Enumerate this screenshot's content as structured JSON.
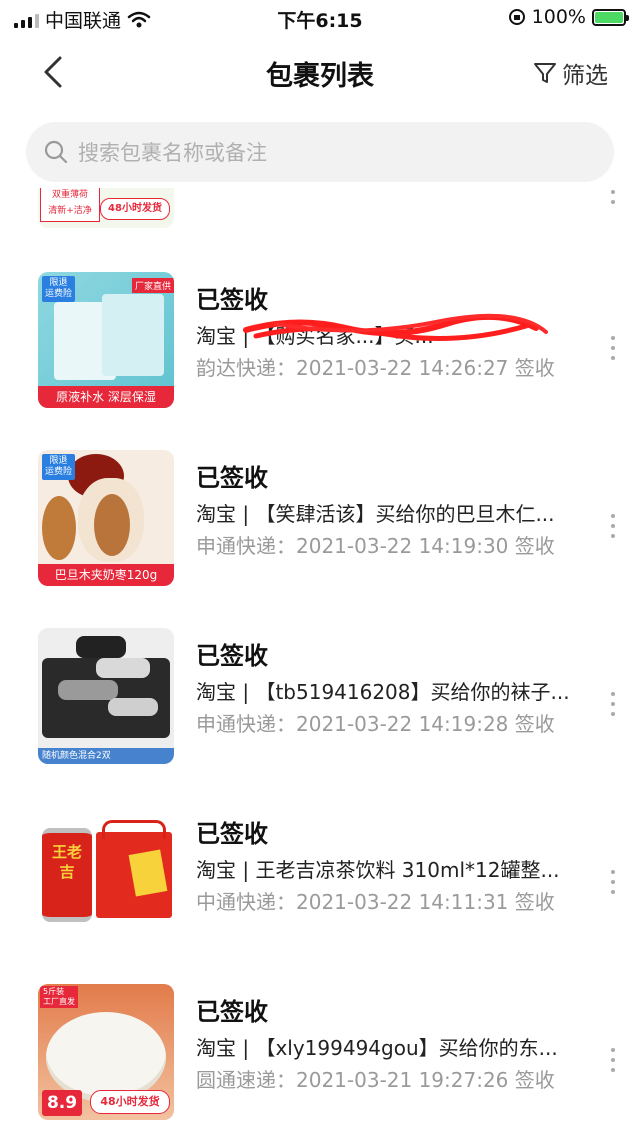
{
  "status_bar": {
    "carrier": "中国联通",
    "time": "下午6:15",
    "battery": "100%",
    "battery_level": 1.0
  },
  "nav": {
    "title": "包裹列表",
    "filter_label": "筛选"
  },
  "search": {
    "placeholder": "搜索包裹名称或备注"
  },
  "partial_item": {
    "thumb_labels": [
      "双重薄荷",
      "清新+洁净",
      "48小时发货"
    ]
  },
  "items": [
    {
      "status": "已签收",
      "title": "淘宝 | 【购买名家...】买...",
      "courier_time": "韵达快递：2021-03-22 14:26:27 签收",
      "thumb_badge": "限退\n运费险",
      "thumb_label": "原液补水 深层保湿",
      "thumb_tag": "厂家直供"
    },
    {
      "status": "已签收",
      "title": "淘宝 | 【笑肆活该】买给你的巴旦木仁...",
      "courier_time": "申通快递：2021-03-22 14:19:30 签收",
      "thumb_badge": "限退\n运费险",
      "thumb_label": "巴旦木夹奶枣120g"
    },
    {
      "status": "已签收",
      "title": "淘宝 | 【tb519416208】买给你的袜子...",
      "courier_time": "申通快递：2021-03-22 14:19:28 签收",
      "thumb_label": "随机颜色混合2双"
    },
    {
      "status": "已签收",
      "title": "淘宝 | 王老吉凉茶饮料 310ml*12罐整...",
      "courier_time": "中通快递：2021-03-22 14:11:31 签收",
      "thumb_can_text": "王老吉"
    },
    {
      "status": "已签收",
      "title": "淘宝 | 【xly199494gou】买给你的东...",
      "courier_time": "圆通速递：2021-03-21 19:27:26 签收",
      "thumb_price": "8.9",
      "thumb_label": "48小时发货",
      "thumb_tag": "5斤装\n工厂直发"
    }
  ],
  "colors": {
    "accent_red": "#e6283a",
    "badge_blue": "#2a7fe0",
    "status_text": "#111111",
    "muted_text": "#9a9a9a"
  }
}
